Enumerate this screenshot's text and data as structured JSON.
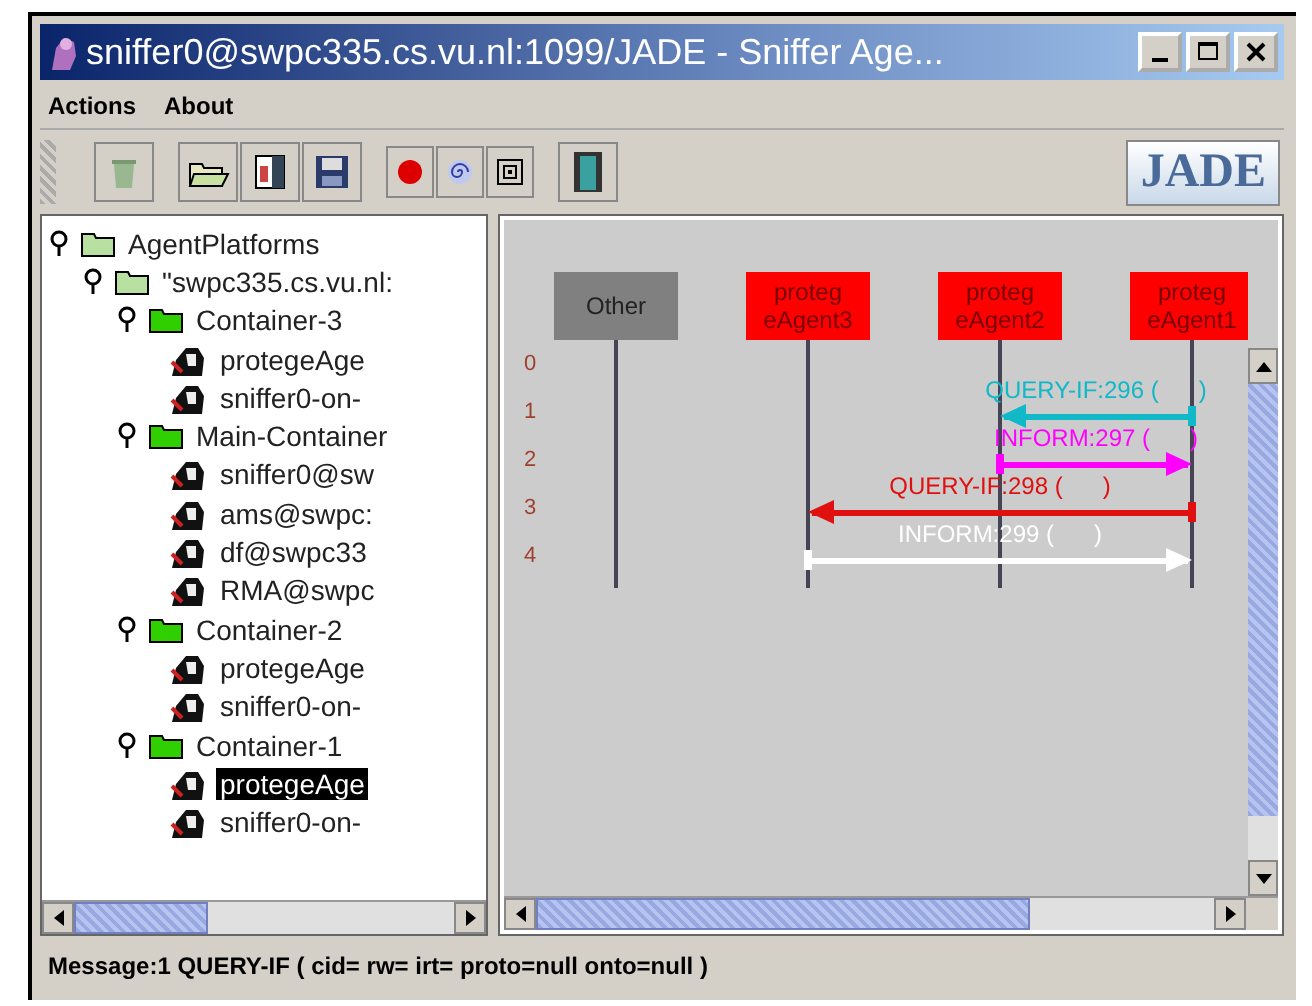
{
  "window": {
    "title": "sniffer0@swpc335.cs.vu.nl:1099/JADE - Sniffer Age..."
  },
  "menu": [
    "Actions",
    "About"
  ],
  "logo": "JADE",
  "tree": [
    {
      "label": "AgentPlatforms",
      "kind": "platform",
      "expanded": true,
      "children": [
        {
          "label": "\"swpc335.cs.vu.nl:",
          "kind": "platform",
          "expanded": true,
          "children": [
            {
              "label": "Container-3",
              "kind": "container",
              "expanded": true,
              "children": [
                {
                  "label": "protegeAge",
                  "kind": "agent",
                  "selected": false
                },
                {
                  "label": "sniffer0-on-",
                  "kind": "agent",
                  "selected": false
                }
              ]
            },
            {
              "label": "Main-Container",
              "kind": "container",
              "expanded": true,
              "children": [
                {
                  "label": "sniffer0@sw",
                  "kind": "agent",
                  "selected": false
                },
                {
                  "label": "ams@swpc:",
                  "kind": "agent",
                  "selected": false
                },
                {
                  "label": "df@swpc33",
                  "kind": "agent",
                  "selected": false
                },
                {
                  "label": "RMA@swpc",
                  "kind": "agent",
                  "selected": false
                }
              ]
            },
            {
              "label": "Container-2",
              "kind": "container",
              "expanded": true,
              "children": [
                {
                  "label": "protegeAge",
                  "kind": "agent",
                  "selected": false
                },
                {
                  "label": "sniffer0-on-",
                  "kind": "agent",
                  "selected": false
                }
              ]
            },
            {
              "label": "Container-1",
              "kind": "container",
              "expanded": true,
              "children": [
                {
                  "label": "protegeAge",
                  "kind": "agent",
                  "selected": true
                },
                {
                  "label": "sniffer0-on-",
                  "kind": "agent",
                  "selected": false
                }
              ]
            }
          ]
        }
      ]
    }
  ],
  "lifelines": [
    {
      "label": "Other",
      "color": "#808080"
    },
    {
      "label": "proteg eAgent3",
      "color": "#ff0000"
    },
    {
      "label": "proteg eAgent2",
      "color": "#ff0000"
    },
    {
      "label": "proteg eAgent1",
      "color": "#ff0000"
    }
  ],
  "row_numbers": [
    "0",
    "1",
    "2",
    "3",
    "4"
  ],
  "messages": [
    {
      "label": "QUERY-IF:296 (      )",
      "color": "#10b8c8",
      "lanes": [
        {
          "start": false,
          "end": false
        },
        {
          "start": false,
          "end": false
        },
        {
          "start": false,
          "end": true
        },
        {
          "start": true,
          "end": false
        }
      ]
    },
    {
      "label": "INFORM:297 (      )",
      "color": "#ff00ff",
      "lanes": [
        {
          "start": false,
          "end": false
        },
        {
          "start": false,
          "end": false
        },
        {
          "start": true,
          "end": false
        },
        {
          "start": false,
          "end": true
        }
      ]
    },
    {
      "label": "QUERY-IF:298 (      )",
      "color": "#e01010",
      "lanes": [
        {
          "start": false,
          "end": false
        },
        {
          "start": false,
          "end": true
        },
        {
          "start": false,
          "end": false
        },
        {
          "start": true,
          "end": false
        }
      ]
    },
    {
      "label": "INFORM:299 (      )",
      "color": "#ffffff",
      "lanes": [
        {
          "start": false,
          "end": false
        },
        {
          "start": true,
          "end": false
        },
        {
          "start": false,
          "end": false
        },
        {
          "start": false,
          "end": true
        }
      ]
    }
  ],
  "status_bar": "Message:1 QUERY-IF ( cid=  rw=  irt=  proto=null onto=null )"
}
